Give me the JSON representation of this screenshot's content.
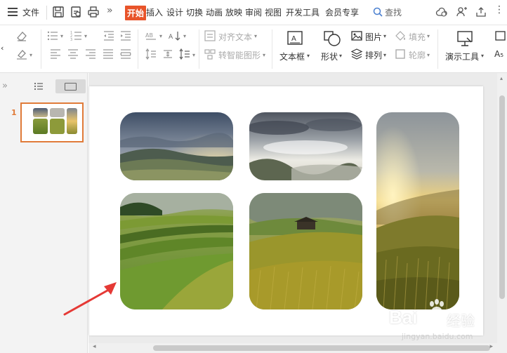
{
  "menu": {
    "file": "文件",
    "tabs": [
      "开始",
      "插入",
      "设计",
      "切换",
      "动画",
      "放映",
      "审阅",
      "视图",
      "开发工具",
      "会员专享"
    ],
    "active_tab": 0,
    "search": "查找"
  },
  "ribbon": {
    "align_text": "对齐文本",
    "smart_shape": "转智能图形",
    "textbox": "文本框",
    "shape": "形状",
    "picture": "图片",
    "fill": "填充",
    "arrange": "排列",
    "outline": "轮廓",
    "presentation_tools": "演示工具",
    "partial": "A₅"
  },
  "left_panel": {
    "slide_number": "1"
  },
  "watermark": {
    "line1": "Bai",
    "line2": "经验",
    "line3": "jingyan.baidu.com"
  },
  "colors": {
    "accent": "#e8542a",
    "thumb_border": "#e07b39",
    "arrow": "#e53935"
  }
}
